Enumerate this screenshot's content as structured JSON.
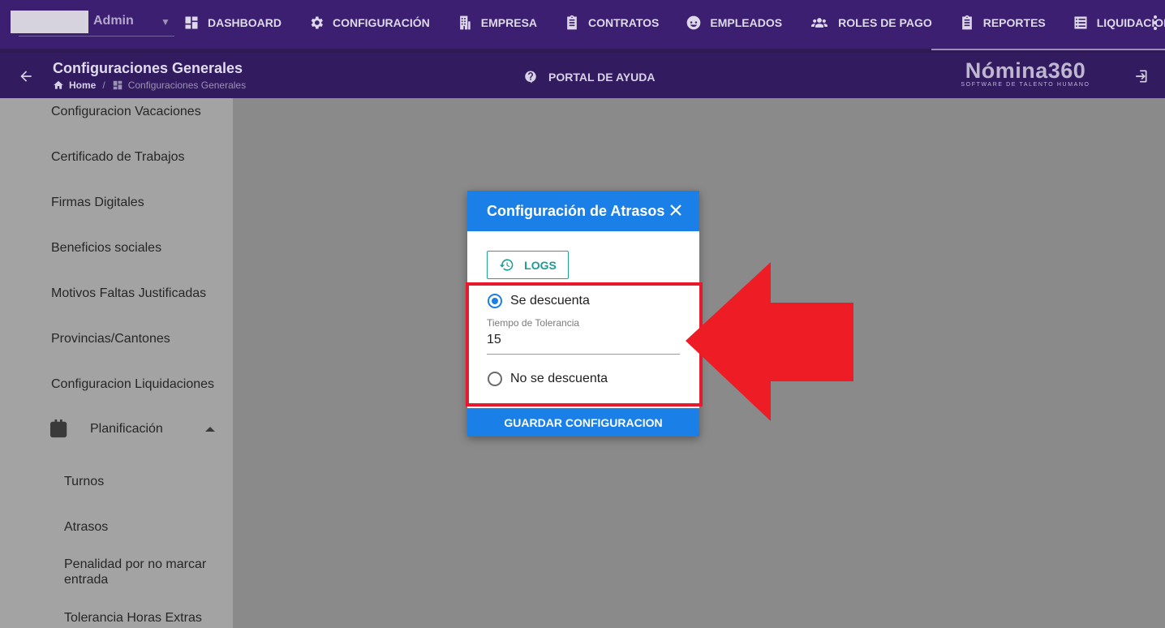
{
  "topnav": {
    "user": "Admin",
    "menu": [
      {
        "label": "DASHBOARD",
        "icon": "dashboard-icon"
      },
      {
        "label": "CONFIGURACIÓN",
        "icon": "gear-icon"
      },
      {
        "label": "EMPRESA",
        "icon": "building-icon"
      },
      {
        "label": "CONTRATOS",
        "icon": "clipboard-icon"
      },
      {
        "label": "EMPLEADOS",
        "icon": "face-icon"
      },
      {
        "label": "ROLES DE PAGO",
        "icon": "group-icon"
      },
      {
        "label": "REPORTES",
        "icon": "clipboard-icon"
      },
      {
        "label": "LIQUIDACIONES",
        "icon": "list-icon"
      }
    ]
  },
  "header": {
    "title": "Configuraciones Generales",
    "breadcrumb": {
      "home": "Home",
      "current": "Configuraciones Generales"
    },
    "help": "PORTAL DE AYUDA",
    "logo": {
      "brand": "Nómina360",
      "tagline": "SOFTWARE DE TALENTO HUMANO"
    }
  },
  "sidebar": {
    "items": [
      "Configuracion Vacaciones",
      "Certificado de Trabajos",
      "Firmas Digitales",
      "Beneficios sociales",
      "Motivos Faltas Justificadas",
      "Provincias/Cantones",
      "Configuracion Liquidaciones"
    ],
    "group": {
      "label": "Planificación",
      "children": [
        "Turnos",
        "Atrasos",
        "Penalidad por no marcar entrada",
        "Tolerancia Horas Extras"
      ]
    }
  },
  "dialog": {
    "title": "Configuración de Atrasos",
    "logs_label": "LOGS",
    "option_discount": "Se descuenta",
    "option_no_discount": "No se descuenta",
    "selected_option": "Se descuenta",
    "tolerance_label": "Tiempo de Tolerancia",
    "tolerance_value": "15",
    "save_label": "GUARDAR CONFIGURACION"
  },
  "colors": {
    "topnav": "#3c1f70",
    "subheader": "#331b60",
    "dialog_accent": "#1a7fe6",
    "logs_accent": "#1fa39a",
    "annotation": "#e8192c"
  }
}
